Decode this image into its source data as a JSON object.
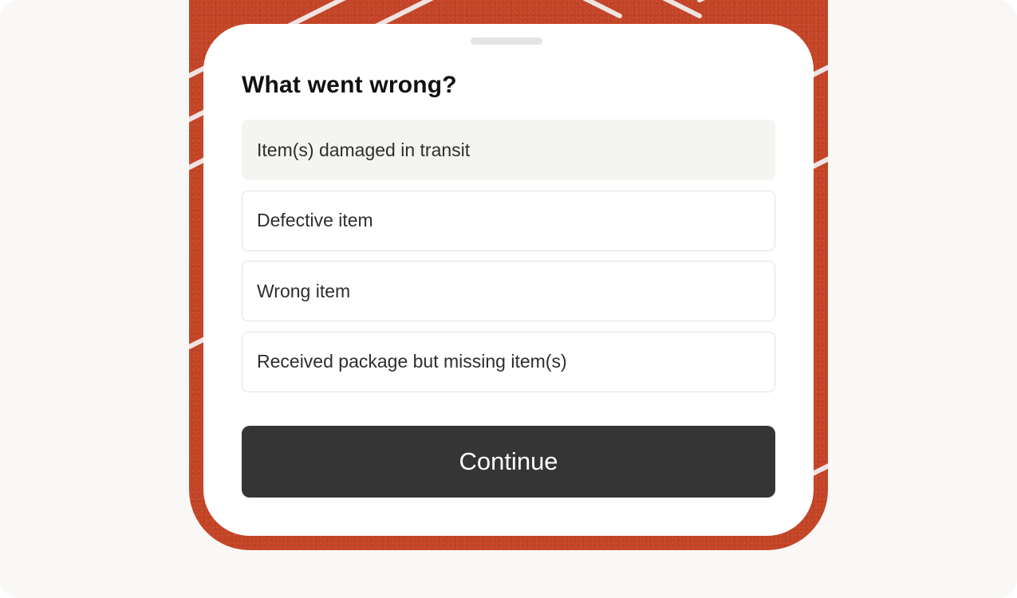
{
  "sheet": {
    "title": "What went wrong?",
    "options": [
      {
        "label": "Item(s) damaged in transit",
        "selected": true
      },
      {
        "label": "Defective item",
        "selected": false
      },
      {
        "label": "Wrong item",
        "selected": false
      },
      {
        "label": "Received package but missing item(s)",
        "selected": false
      }
    ],
    "continue_label": "Continue"
  },
  "background": {
    "description": "red running track surface with white lane lines",
    "track_color": "#c44426",
    "line_color": "#f2f2f2"
  },
  "colors": {
    "button": "#353535",
    "selected_option": "#f4f4f1",
    "page": "#f9f8f6"
  }
}
